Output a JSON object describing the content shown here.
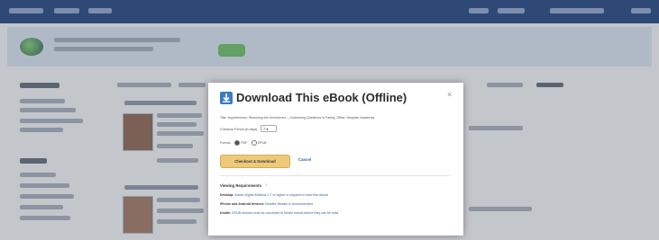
{
  "modal": {
    "title": "Download This eBook (Offline)",
    "close": "×",
    "description": "Title: Hypertension: Resolving the Unresolved — Answering Questions in Family, Office, Hospital, Academia",
    "pages_label": "Checkout Period (in days):",
    "pages_value": "7",
    "format_label": "Format:",
    "format_options": [
      "PDF",
      "EPUB"
    ],
    "download_button": "Checkout & Download",
    "cancel_link": "Cancel",
    "requirements": {
      "title": "Viewing Requirements",
      "rows": [
        {
          "key": "Desktop:",
          "value": "Adobe Digital Editions 1.7 or higher is required to view this ebook"
        },
        {
          "key": "iPhone and Android devices:",
          "value": "Bluefire Reader is recommended"
        },
        {
          "key": "Kindle:",
          "value": "EPUB ebooks must be converted to Kindle format before they can be read"
        }
      ]
    }
  },
  "colors": {
    "topbar": "#1f3e73",
    "button": "#efc97a",
    "link": "#2f5f9c",
    "icon": "#3a7bc8"
  }
}
